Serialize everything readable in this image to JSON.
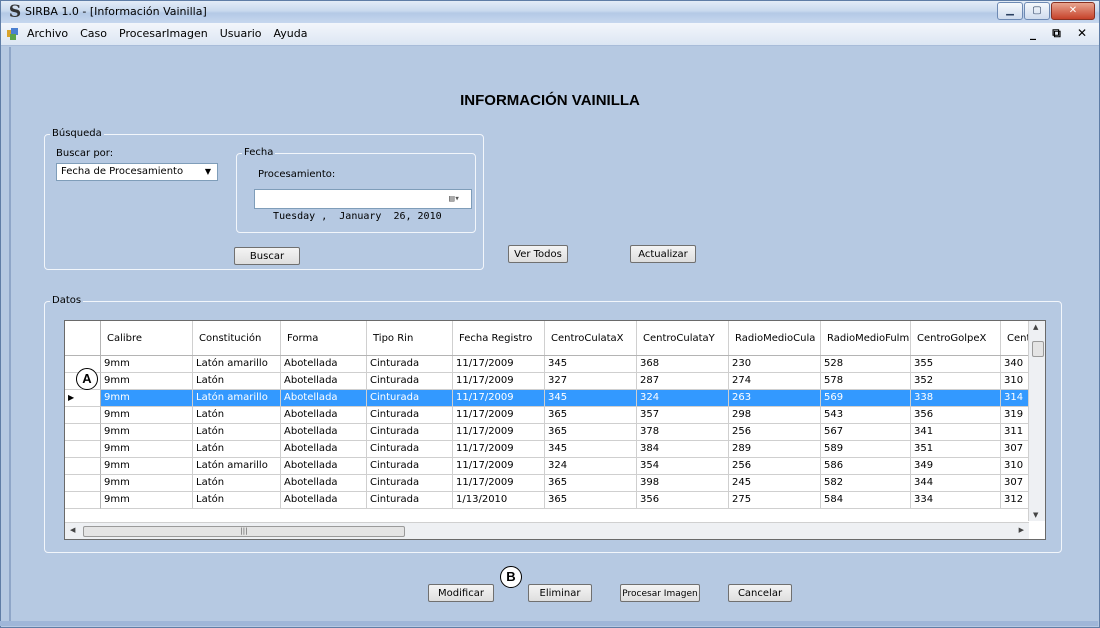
{
  "window": {
    "title": "SIRBA 1.0 - [Información Vainilla]",
    "app_icon": "S"
  },
  "menu": {
    "items": [
      "Archivo",
      "Caso",
      "ProcesarImagen",
      "Usuario",
      "Ayuda"
    ],
    "mdi_controls": "_ ⧉ ✕"
  },
  "page": {
    "title": "INFORMACIÓN VAINILLA"
  },
  "busqueda": {
    "legend": "Búsqueda",
    "buscar_por_label": "Buscar por:",
    "buscar_por_value": "Fecha de Procesamiento",
    "fecha_legend": "Fecha",
    "procesamiento_label": "Procesamiento:",
    "date_value": "Tuesday ,  January  26, 2010",
    "buscar_button": "Buscar"
  },
  "actions": {
    "ver_todos": "Ver Todos",
    "actualizar": "Actualizar"
  },
  "datos": {
    "legend": "Datos",
    "columns": [
      "Calibre",
      "Constitución",
      "Forma",
      "Tipo Rin",
      "Fecha Registro",
      "CentroCulataX",
      "CentroCulataY",
      "RadioMedioCula",
      "RadioMedioFulm",
      "CentroGolpeX",
      "CentroGo"
    ],
    "rows": [
      [
        "9mm",
        "Latón amarillo",
        "Abotellada",
        "Cinturada",
        "11/17/2009",
        "345",
        "368",
        "230",
        "528",
        "355",
        "340"
      ],
      [
        "9mm",
        "Latón",
        "Abotellada",
        "Cinturada",
        "11/17/2009",
        "327",
        "287",
        "274",
        "578",
        "352",
        "310"
      ],
      [
        "9mm",
        "Latón amarillo",
        "Abotellada",
        "Cinturada",
        "11/17/2009",
        "345",
        "324",
        "263",
        "569",
        "338",
        "314"
      ],
      [
        "9mm",
        "Latón",
        "Abotellada",
        "Cinturada",
        "11/17/2009",
        "365",
        "357",
        "298",
        "543",
        "356",
        "319"
      ],
      [
        "9mm",
        "Latón",
        "Abotellada",
        "Cinturada",
        "11/17/2009",
        "365",
        "378",
        "256",
        "567",
        "341",
        "311"
      ],
      [
        "9mm",
        "Latón",
        "Abotellada",
        "Cinturada",
        "11/17/2009",
        "345",
        "384",
        "289",
        "589",
        "351",
        "307"
      ],
      [
        "9mm",
        "Latón amarillo",
        "Abotellada",
        "Cinturada",
        "11/17/2009",
        "324",
        "354",
        "256",
        "586",
        "349",
        "310"
      ],
      [
        "9mm",
        "Latón",
        "Abotellada",
        "Cinturada",
        "11/17/2009",
        "365",
        "398",
        "245",
        "582",
        "344",
        "307"
      ],
      [
        "9mm",
        "Latón",
        "Abotellada",
        "Cinturada",
        "1/13/2010",
        "365",
        "356",
        "275",
        "584",
        "334",
        "312"
      ]
    ],
    "selected_row": 2
  },
  "footer_buttons": {
    "modificar": "Modificar",
    "eliminar": "Eliminar",
    "procesar_imagen": "Procesar Imagen",
    "cancelar": "Cancelar"
  },
  "annotations": {
    "a": "A",
    "b": "B"
  },
  "colors": {
    "background": "#b6c9e2",
    "selection": "#3399ff"
  }
}
